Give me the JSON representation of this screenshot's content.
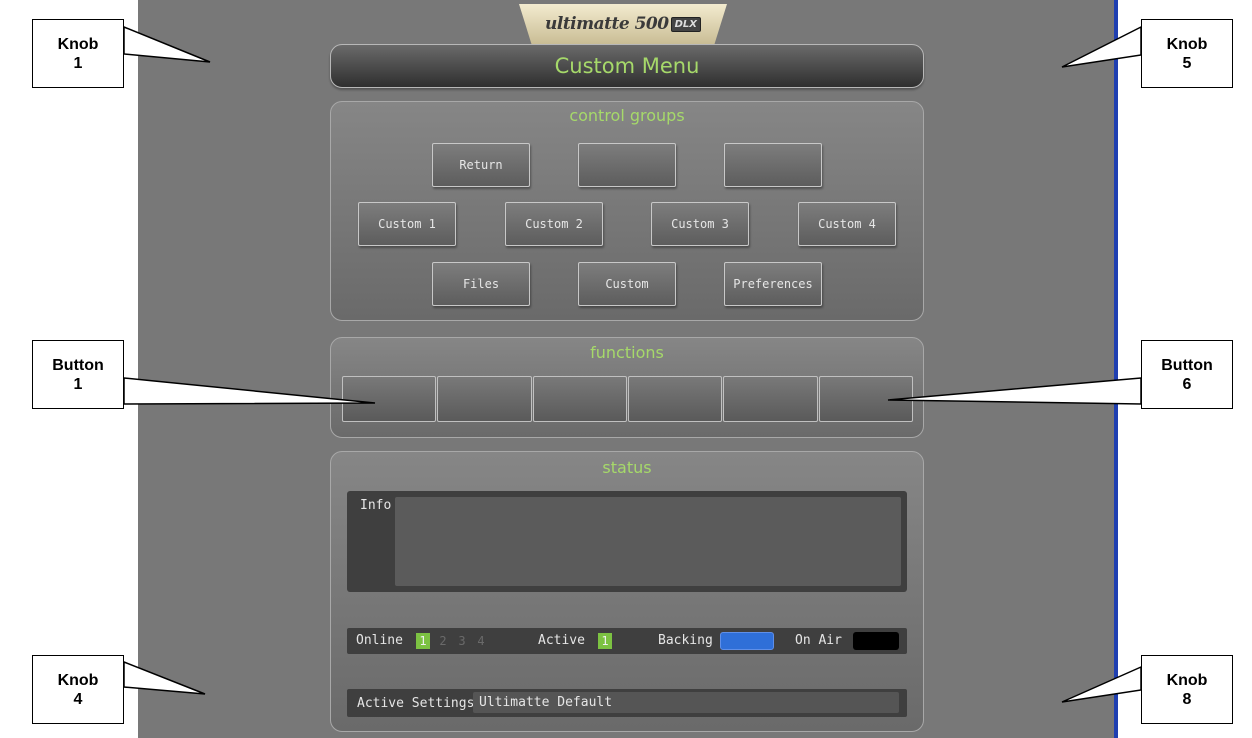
{
  "logo": {
    "text": "ultimatte 500",
    "badge": "DLX"
  },
  "title": "Custom Menu",
  "control_groups": {
    "heading": "control groups",
    "rows": [
      [
        "Return",
        "",
        ""
      ],
      [
        "Custom 1",
        "Custom 2",
        "Custom 3",
        "Custom 4"
      ],
      [
        "Files",
        "Custom",
        "Preferences"
      ]
    ]
  },
  "functions": {
    "heading": "functions",
    "buttons": [
      "",
      "",
      "",
      "",
      "",
      ""
    ]
  },
  "status": {
    "heading": "status",
    "info_label": "Info",
    "info_text": "",
    "online_label": "Online",
    "online_numbers": [
      "1",
      "2",
      "3",
      "4"
    ],
    "online_active_index": 0,
    "active_label": "Active",
    "active_value": "1",
    "backing_label": "Backing",
    "backing_color": "#2f6fd8",
    "on_air_label": "On Air",
    "on_air_color": "#000000",
    "active_settings_label": "Active Settings",
    "active_settings_value": "Ultimatte Default"
  },
  "callouts": {
    "knob1": [
      "Knob",
      "1"
    ],
    "knob4": [
      "Knob",
      "4"
    ],
    "knob5": [
      "Knob",
      "5"
    ],
    "knob8": [
      "Knob",
      "8"
    ],
    "button1": [
      "Button",
      "1"
    ],
    "button6": [
      "Button",
      "6"
    ]
  },
  "colors": {
    "accent_green": "#a6d96a",
    "indicator_green": "#7cc242",
    "screen_gray": "#787878",
    "edge_blue": "#1f3fb0"
  }
}
